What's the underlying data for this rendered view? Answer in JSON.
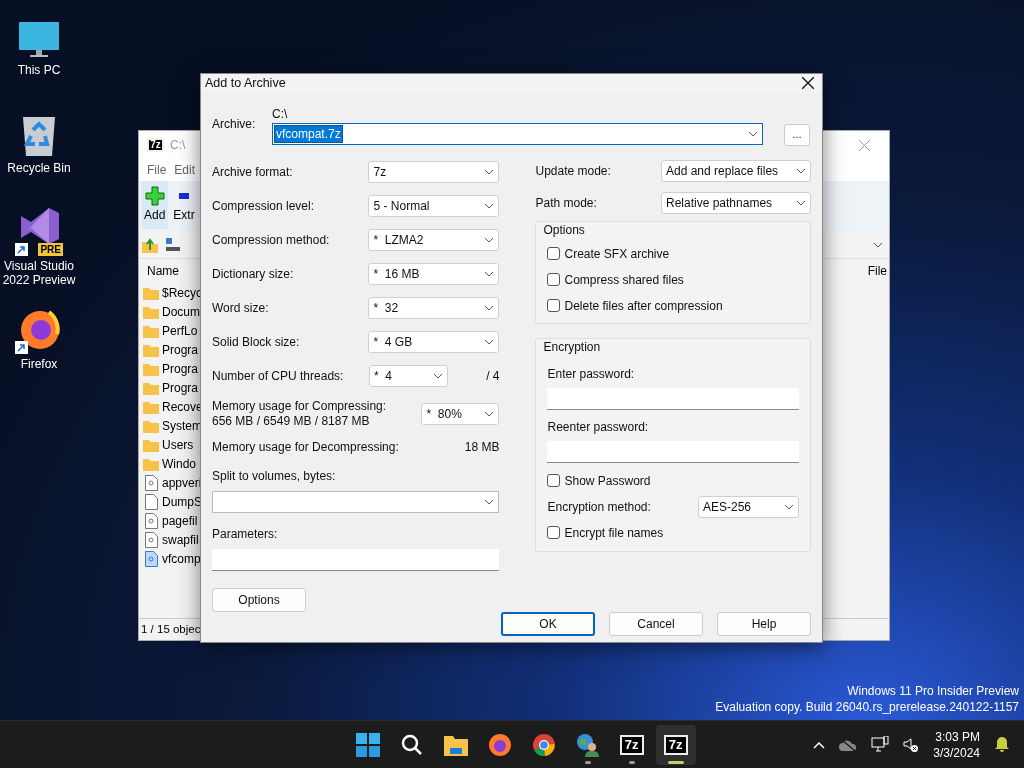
{
  "desktop_icons": [
    {
      "label": "This PC",
      "kind": "pc"
    },
    {
      "label": "Recycle Bin",
      "kind": "bin"
    },
    {
      "label": "Visual Studio 2022 Preview",
      "kind": "vs",
      "badge": "PRE",
      "shortcut": true
    },
    {
      "label": "Firefox",
      "kind": "firefox",
      "shortcut": true
    }
  ],
  "bg_window": {
    "logo": "7z",
    "title": "C:\\",
    "menu": [
      "File",
      "Edit"
    ],
    "toolbar": [
      {
        "label": "Add",
        "kind": "add"
      },
      {
        "label": "Extr",
        "kind": "extract"
      }
    ],
    "column_1": "Name",
    "column_2": "File",
    "files": [
      {
        "name": "$Recyc",
        "kind": "folder"
      },
      {
        "name": "Docum",
        "kind": "folder"
      },
      {
        "name": "PerfLo",
        "kind": "folder"
      },
      {
        "name": "Progra",
        "kind": "folder"
      },
      {
        "name": "Progra",
        "kind": "folder"
      },
      {
        "name": "Progra",
        "kind": "folder"
      },
      {
        "name": "Recove",
        "kind": "folder"
      },
      {
        "name": "System",
        "kind": "folder"
      },
      {
        "name": "Users",
        "kind": "folder"
      },
      {
        "name": "Windo",
        "kind": "folder"
      },
      {
        "name": "appveri",
        "kind": "system"
      },
      {
        "name": "DumpS",
        "kind": "file"
      },
      {
        "name": "pagefil",
        "kind": "system"
      },
      {
        "name": "swapfil",
        "kind": "system"
      },
      {
        "name": "vfcomp",
        "kind": "archive"
      }
    ],
    "status": "1 / 15 objec"
  },
  "dialog": {
    "title": "Add to Archive",
    "archive": {
      "label": "Archive:",
      "folder": "C:\\",
      "value": "vfcompat.7z"
    },
    "browse": "...",
    "left_rows": [
      {
        "kind": "select",
        "label": "Archive format:",
        "value": "7z"
      },
      {
        "kind": "select",
        "label": "Compression level:",
        "value": "5 - Normal"
      },
      {
        "kind": "select",
        "label": "Compression method:",
        "value": "*  LZMA2"
      },
      {
        "kind": "select",
        "label": "Dictionary size:",
        "value": "*  16 MB"
      },
      {
        "kind": "select",
        "label": "Word size:",
        "value": "*  32"
      },
      {
        "kind": "select",
        "label": "Solid Block size:",
        "value": "*  4 GB"
      },
      {
        "kind": "threads",
        "label": "Number of CPU threads:",
        "value": "*  4",
        "note": "/ 4"
      },
      {
        "kind": "memory",
        "label": "Memory usage for Compressing:",
        "detail": "656 MB / 6549 MB / 8187 MB",
        "value": "*  80%"
      },
      {
        "kind": "info",
        "label": "Memory usage for Decompressing:",
        "value": "18 MB"
      }
    ],
    "split": {
      "label": "Split to volumes, bytes:"
    },
    "parameters": {
      "label": "Parameters:"
    },
    "options_button": "Options",
    "update_mode": {
      "label": "Update mode:",
      "value": "Add and replace files"
    },
    "path_mode": {
      "label": "Path mode:",
      "value": "Relative pathnames"
    },
    "options_group": {
      "title": "Options",
      "checkboxes": [
        {
          "label": "Create SFX archive",
          "checked": false
        },
        {
          "label": "Compress shared files",
          "checked": false
        },
        {
          "label": "Delete files after compression",
          "checked": false
        }
      ]
    },
    "encryption": {
      "title": "Encryption",
      "enter_label": "Enter password:",
      "reenter_label": "Reenter password:",
      "show_password": {
        "label": "Show Password",
        "checked": false
      },
      "method_label": "Encryption method:",
      "method_value": "AES-256",
      "encrypt_names": {
        "label": "Encrypt file names",
        "checked": false
      }
    },
    "buttons": [
      {
        "label": "OK",
        "default": true
      },
      {
        "label": "Cancel",
        "default": false
      },
      {
        "label": "Help",
        "default": false
      }
    ]
  },
  "watermark": [
    "Windows 11 Pro Insider Preview",
    "Evaluation copy. Build 26040.rs_prerelease.240122-1157"
  ],
  "taskbar": {
    "apps": [
      {
        "kind": "start",
        "running": false,
        "active": false
      },
      {
        "kind": "search",
        "running": false,
        "active": false
      },
      {
        "kind": "explorer",
        "running": false,
        "active": false
      },
      {
        "kind": "firefox",
        "running": false,
        "active": false
      },
      {
        "kind": "chrome",
        "running": false,
        "active": false
      },
      {
        "kind": "network",
        "running": true,
        "active": false
      },
      {
        "kind": "archiver",
        "logo": "7z",
        "running": true,
        "active": false
      },
      {
        "kind": "archiver",
        "logo": "7z",
        "running": true,
        "active": true
      }
    ],
    "time": "3:03 PM",
    "date": "3/3/2024"
  }
}
